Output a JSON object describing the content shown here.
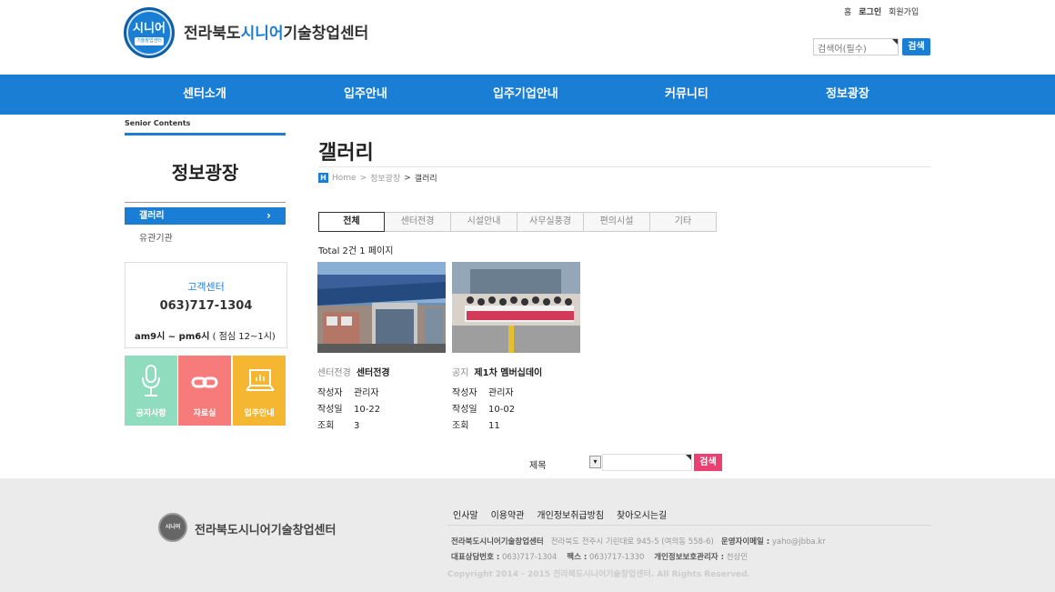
{
  "header": {
    "logo_text": "시니어",
    "logo_sub": "기술창업센터",
    "title_pre": "전라북도",
    "title_hl": "시니어",
    "title_post": "기술창업센터",
    "top_links": [
      "홈",
      "로그인",
      "회원가입"
    ],
    "search_placeholder": "검색어(필수)",
    "search_button": "검색"
  },
  "nav": [
    "센터소개",
    "입주안내",
    "입주기업안내",
    "커뮤니티",
    "정보광장"
  ],
  "sidebar": {
    "label": "Senior Contents",
    "title": "정보광장",
    "items": [
      "갤러리",
      "유관기관"
    ],
    "active_chevron": "›",
    "cs_title": "고객센터",
    "cs_phone": "063)717-1304",
    "cs_hours_bold": "am9시 ~ pm6시",
    "cs_hours_rest": " ( 점심 12~1시)",
    "quick": [
      "공지사항",
      "자료실",
      "입주안내"
    ]
  },
  "content": {
    "title": "갤러리",
    "breadcrumb": {
      "icon": "H",
      "home": "Home",
      "sep": ">",
      "parent": "정보광장",
      "current": "갤러리"
    },
    "tabs": [
      "전체",
      "센터전경",
      "시설안내",
      "사무실풍경",
      "편의시설",
      "기타"
    ],
    "total": "Total 2건 1 페이지",
    "cards": [
      {
        "category": "센터전경",
        "title": "센터전경",
        "author_k": "작성자",
        "author": "관리자",
        "date_k": "작성일",
        "date": "10-22",
        "views_k": "조회",
        "views": "3"
      },
      {
        "category": "공지",
        "title": "제1차 멤버십데이",
        "author_k": "작성자",
        "author": "관리자",
        "date_k": "작성일",
        "date": "10-02",
        "views_k": "조회",
        "views": "11"
      }
    ],
    "search_label": "제목",
    "search_button": "검색"
  },
  "footer": {
    "logo_text": "시니어",
    "title": "전라북도시니어기술창업센터",
    "links": [
      "인사말",
      "이용약관",
      "개인정보취급방침",
      "찾아오시는길"
    ],
    "org": "전라북도시니어기술창업센터",
    "address": "전라북도 전주시 기린대로 945-5 (여의동 558-6)",
    "email_k": "운영자이메일 :",
    "email": "yaho@jbba.kr",
    "tel_k": "대표상담번호 :",
    "tel": "063)717-1304",
    "fax_k": "팩스 :",
    "fax": "063)717-1330",
    "privacy_k": "개인정보보호관리자 :",
    "privacy": "천상민",
    "copyright": "Copyright 2014 - 2015 전라북도시니어기술창업센터. All Rights Reserved."
  },
  "colors": {
    "primary": "#1a7fd4",
    "pink": "#e94174",
    "quick_green": "#8fdcbf",
    "quick_pink": "#f77b7b",
    "quick_yellow": "#f5b731"
  }
}
